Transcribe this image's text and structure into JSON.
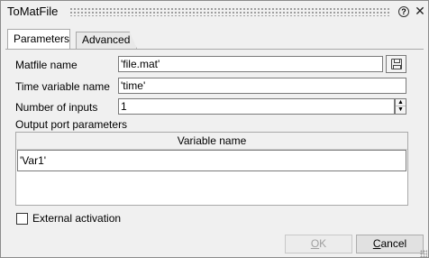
{
  "window": {
    "title": "ToMatFile",
    "help_symbol": "?",
    "close_symbol": "✕"
  },
  "tabs": [
    {
      "label": "Parameters",
      "active": true
    },
    {
      "label": "Advanced",
      "active": false
    }
  ],
  "fields": {
    "matfile_name": {
      "label": "Matfile name",
      "value": "'file.mat'"
    },
    "time_variable_name": {
      "label": "Time variable name",
      "value": "'time'"
    },
    "number_of_inputs": {
      "label": "Number of inputs",
      "value": "1"
    }
  },
  "output_ports": {
    "section_label": "Output port parameters",
    "column_header": "Variable name",
    "rows": [
      "'Var1'"
    ]
  },
  "external_activation": {
    "label": "External activation",
    "checked": false
  },
  "buttons": {
    "ok": "OK",
    "cancel": "Cancel"
  },
  "icons": {
    "browse": "floppy-disk-icon",
    "spin_up": "▲",
    "spin_down": "▼"
  }
}
